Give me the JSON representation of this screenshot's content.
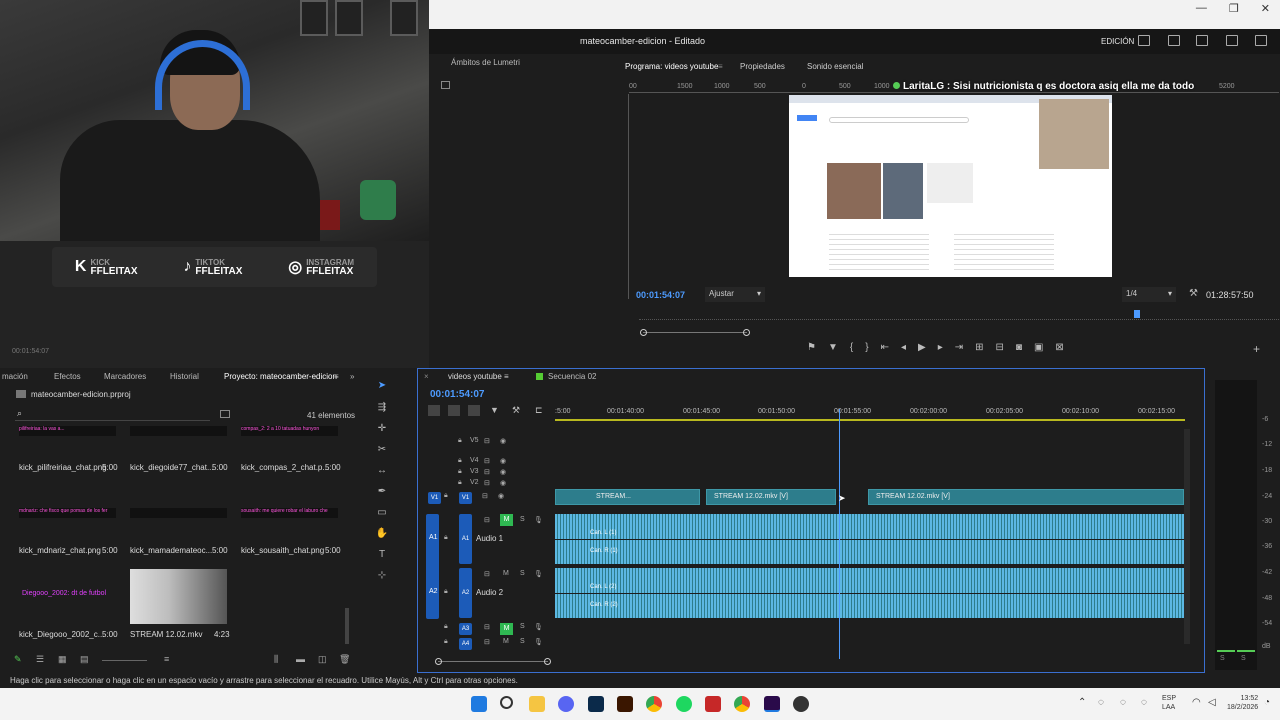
{
  "window": {
    "app_title": "mateocamber-edicion - Editado",
    "workspace": "EDICIÓN",
    "controls": [
      "—",
      "❐",
      "✕"
    ]
  },
  "overlay": {
    "socials": [
      {
        "icon": "K",
        "platform": "KICK",
        "handle": "FFLEITAX"
      },
      {
        "icon": "♪",
        "platform": "TIKTOK",
        "handle": "FFLEITAX"
      },
      {
        "icon": "◎",
        "platform": "INSTAGRAM",
        "handle": "FFLEITAX"
      }
    ],
    "webcam_timecode": "00:01:54:07"
  },
  "lumetri": {
    "tab": "Ámbitos de Lumetri"
  },
  "program": {
    "tabs": [
      "Programa: videos youtube",
      "Propiedades",
      "Sonido esencial"
    ],
    "ruler_ticks": [
      "00",
      "1500",
      "1000",
      "500",
      "0",
      "500",
      "1000",
      "5200"
    ],
    "chat_user": "LaritaLG",
    "chat_text": " : Sisi nutricionista q es doctora asiq ella me da todo",
    "timecode": "00:01:54:07",
    "fit": "Ajustar",
    "resolution": "1/4",
    "duration": "01:28:57:50",
    "transport_icons": [
      "mark-in-icon",
      "mark-out-icon",
      "go-in-icon",
      "step-back-icon",
      "play-icon",
      "step-forward-icon",
      "go-out-icon",
      "lift-icon",
      "extract-icon",
      "export-frame-icon"
    ]
  },
  "project": {
    "tabs": [
      "mación",
      "Efectos",
      "Marcadores",
      "Historial",
      "Proyecto: mateocamber-edicion"
    ],
    "file": "mateocamber-edicion.prproj",
    "count": "41 elementos",
    "items": [
      {
        "label": "kick_pilifreiriaa_chat.png",
        "dur": "5:00",
        "preview": "pilifreiriaa: la vas a..."
      },
      {
        "label": "kick_diegoide77_chat...",
        "dur": "5:00",
        "preview": ""
      },
      {
        "label": "kick_compas_2_chat.p...",
        "dur": "5:00",
        "preview": "compas_2: 2 a 10 tatuadas hunyon"
      },
      {
        "label": "kick_mdnariz_chat.png",
        "dur": "5:00",
        "preview": "mdnariz: che fisco que pomas de los fer"
      },
      {
        "label": "kick_mamademateoc...",
        "dur": "5:00",
        "preview": ""
      },
      {
        "label": "kick_sousaith_chat.png",
        "dur": "5:00",
        "preview": "sousaith: me quiere robar el laburo che"
      },
      {
        "label": "kick_Diegooo_2002_c...",
        "dur": "5:00",
        "preview": "Diegooo_2002: dt de futbol"
      },
      {
        "label": "STREAM 12.02.mkv",
        "dur": "4:23",
        "preview": ""
      }
    ]
  },
  "timeline": {
    "tabs": [
      "videos youtube",
      "Secuencia 02"
    ],
    "timecode": "00:01:54:07",
    "ruler": [
      ":5:00",
      "00:01:40:00",
      "00:01:45:00",
      "00:01:50:00",
      "00:01:55:00",
      "00:02:00:00",
      "00:02:05:00",
      "00:02:10:00",
      "00:02:15:00"
    ],
    "video_tracks": [
      "V5",
      "V4",
      "V3",
      "V2",
      "V1"
    ],
    "audio_tracks": [
      {
        "id": "A1",
        "name": "Audio 1"
      },
      {
        "id": "A2",
        "name": "Audio 2"
      },
      {
        "id": "A3",
        "name": ""
      },
      {
        "id": "A4",
        "name": ""
      }
    ],
    "clips": [
      "STREAM...",
      "STREAM 12.02.mkv [V]",
      "STREAM 12.02.mkv [V]"
    ],
    "channel_labels": [
      "Can. L (1)",
      "Can. R (1)",
      "Can. L (2)",
      "Can. R (2)"
    ]
  },
  "meter": {
    "db": [
      "-6",
      "-12",
      "-18",
      "-24",
      "-30",
      "-36",
      "-42",
      "-48",
      "-54",
      "dB"
    ],
    "channels": [
      "S",
      "S"
    ]
  },
  "status_bar": "Haga clic para seleccionar o haga clic en un espacio vacío y arrastre para seleccionar el recuadro. Utilice Mayús, Alt y Ctrl para otras opciones.",
  "taskbar": {
    "lang": [
      "ESP",
      "LAA"
    ],
    "time": "13:52",
    "date": "18/2/2026",
    "apps": [
      "windows-start",
      "search",
      "file-explorer",
      "discord",
      "photoshop",
      "illustrator",
      "chrome",
      "spotify",
      "app",
      "chrome-alt",
      "premiere",
      "obs"
    ]
  }
}
